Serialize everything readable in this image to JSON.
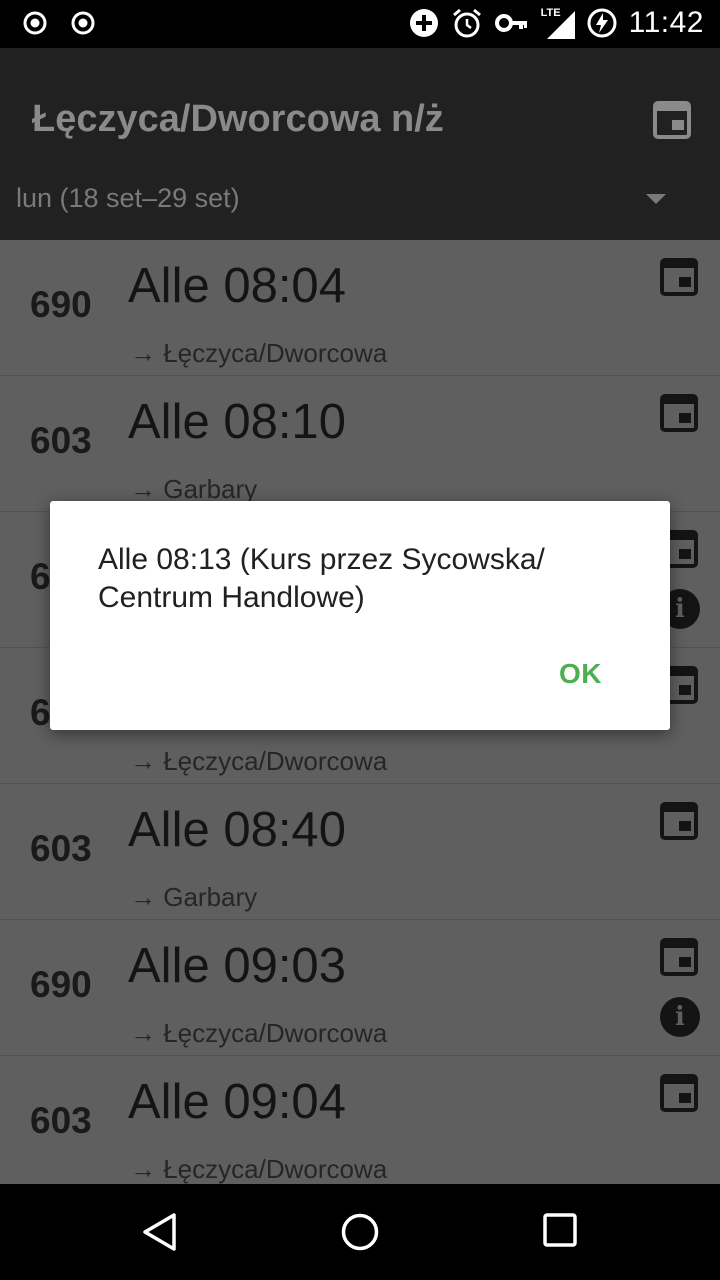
{
  "status_bar": {
    "time": "11:42",
    "left_icons": [
      "radio-icon",
      "radio-icon"
    ],
    "right_icons": [
      "add-circle-icon",
      "alarm-icon",
      "vpn-key-icon",
      "lte-signal-icon",
      "battery-charging-icon"
    ],
    "network_label": "LTE"
  },
  "app_bar": {
    "title": "Łęczyca/Dworcowa n/ż",
    "date_range": "lun (18 set–29 set)"
  },
  "departures": [
    {
      "line": "690",
      "time": "Alle 08:04",
      "destination": "→ Łęczyca/Dworcowa",
      "info": false
    },
    {
      "line": "603",
      "time": "Alle 08:10",
      "destination": "→ Garbary",
      "info": false
    },
    {
      "line": "6",
      "time": "",
      "destination": "",
      "info": true
    },
    {
      "line": "6",
      "time": "",
      "destination": "→ Łęczyca/Dworcowa",
      "info": false
    },
    {
      "line": "603",
      "time": "Alle 08:40",
      "destination": "→ Garbary",
      "info": false
    },
    {
      "line": "690",
      "time": "Alle 09:03",
      "destination": "→ Łęczyca/Dworcowa",
      "info": true
    },
    {
      "line": "603",
      "time": "Alle 09:04",
      "destination": "→ Łęczyca/Dworcowa",
      "info": false
    }
  ],
  "dialog": {
    "message": "Alle 08:13 (Kurs przez Sycowska/ Centrum Handlowe)",
    "ok_label": "OK"
  },
  "info_glyph": "i",
  "colors": {
    "accent": "#4caf50",
    "app_bar": "#212121",
    "list_dimmed": "#5f5f5f"
  }
}
